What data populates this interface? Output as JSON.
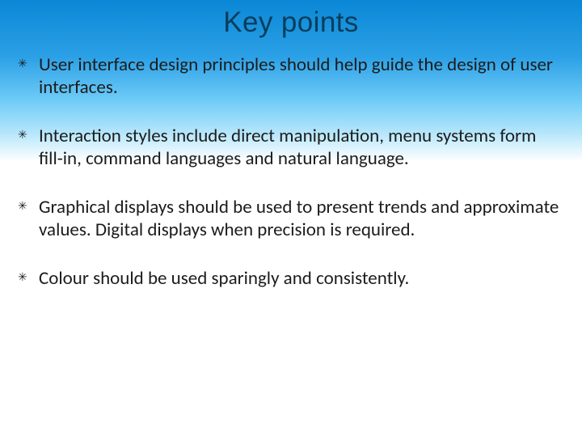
{
  "title": "Key points",
  "bullets": [
    "User interface design principles should help guide the design of user interfaces.",
    "Interaction styles include direct manipulation, menu systems form fill-in, command languages and natural language.",
    "Graphical displays should be used to present trends and approximate values. Digital displays when precision is required.",
    "Colour should be used sparingly and consistently."
  ]
}
